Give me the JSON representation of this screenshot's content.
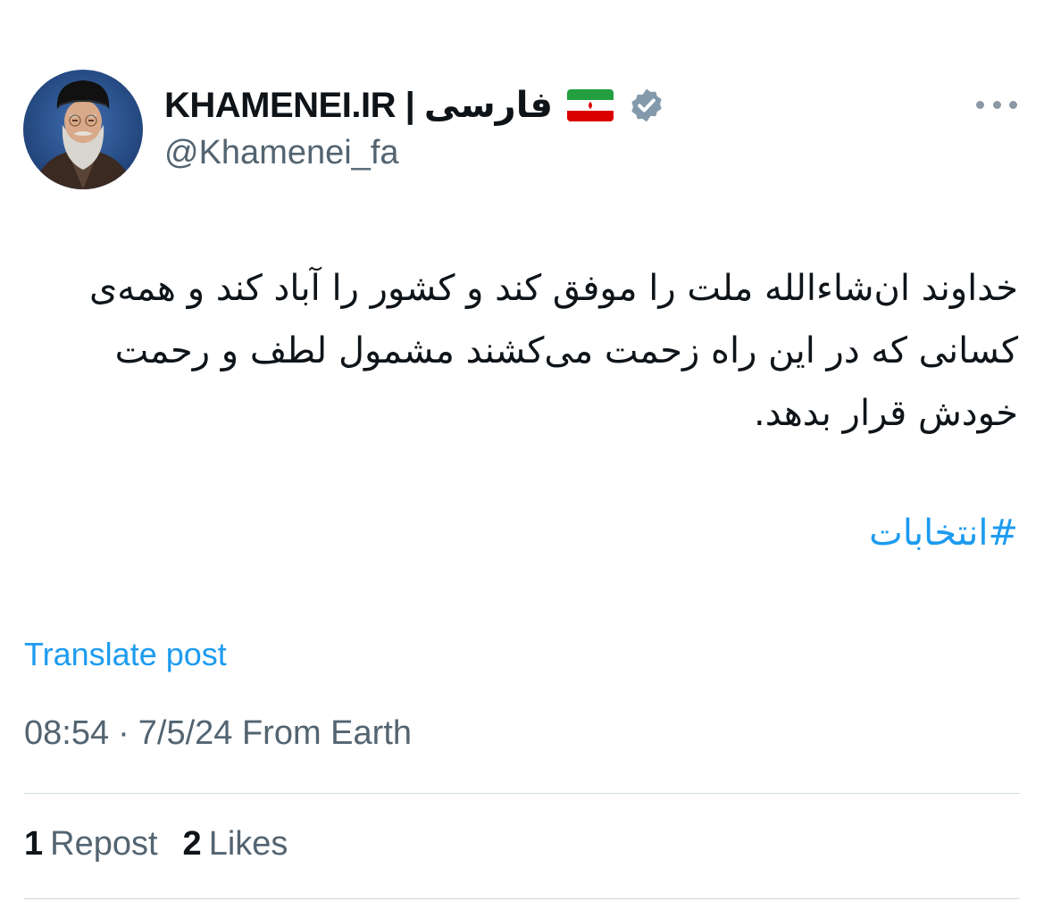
{
  "author": {
    "display_name": "KHAMENEI.IR | فارسی",
    "handle": "@Khamenei_fa",
    "flag_icon": "iran-flag-icon",
    "verified_icon": "verified-badge-icon",
    "verified_color": "#829aab"
  },
  "post": {
    "text": "خداوند ان‌شاءالله ملت را موفق کند و کشور را آباد کند و همه‌ی کسانی که در این راه زحمت می‌کشند مشمول لطف و رحمت خودش قرار بدهد.",
    "hashtag": "#انتخابات",
    "translate_label": "Translate post",
    "time": "08:54",
    "separator": "·",
    "date": "7/5/24",
    "source": "From Earth"
  },
  "stats": {
    "reposts_count": "1",
    "reposts_label": "Repost",
    "likes_count": "2",
    "likes_label": "Likes"
  },
  "colors": {
    "link": "#1d9bf0",
    "secondary_text": "#536471",
    "primary_text": "#0f1419",
    "divider": "#cfd9de"
  }
}
